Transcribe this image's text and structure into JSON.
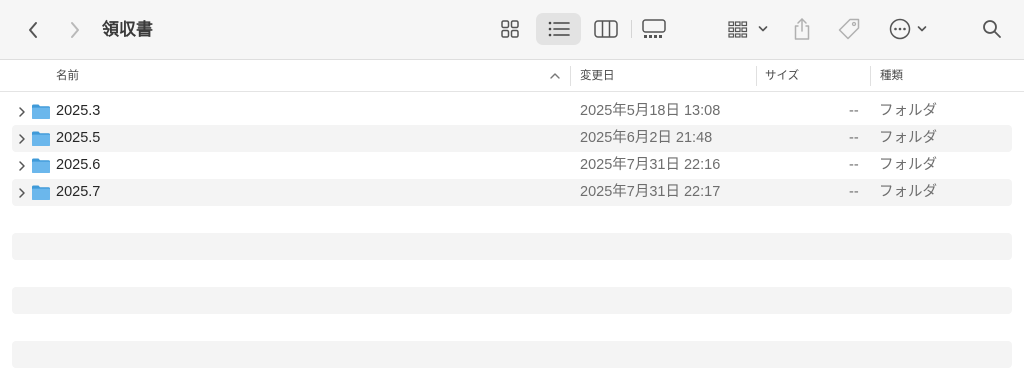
{
  "toolbar": {
    "title": "領収書",
    "buttons": {
      "back": "chevron-left-icon",
      "forward": "chevron-right-icon",
      "icon_view": "grid-icon",
      "list_view": "list-icon",
      "column_view": "columns-icon",
      "gallery_view": "gallery-icon",
      "group": "group-icon",
      "share": "share-icon",
      "tag": "tag-icon",
      "more": "ellipsis-circle-icon",
      "search": "search-icon"
    },
    "selected_view": "list"
  },
  "columns": {
    "name": "名前",
    "date_modified": "変更日",
    "size": "サイズ",
    "kind": "種類",
    "sort": "ascending"
  },
  "rows": [
    {
      "name": "2025.3",
      "date": "2025年5月18日 13:08",
      "size": "--",
      "kind": "フォルダ"
    },
    {
      "name": "2025.5",
      "date": "2025年6月2日 21:48",
      "size": "--",
      "kind": "フォルダ"
    },
    {
      "name": "2025.6",
      "date": "2025年7月31日 22:16",
      "size": "--",
      "kind": "フォルダ"
    },
    {
      "name": "2025.7",
      "date": "2025年7月31日 22:17",
      "size": "--",
      "kind": "フォルダ"
    }
  ],
  "colors": {
    "folder": "#6bb7ec",
    "folder_dark": "#3f9ad8",
    "toolbar_bg": "#f6f6f6",
    "stripe": "#f4f4f4",
    "selected_view_bg": "#e3e3e3"
  }
}
